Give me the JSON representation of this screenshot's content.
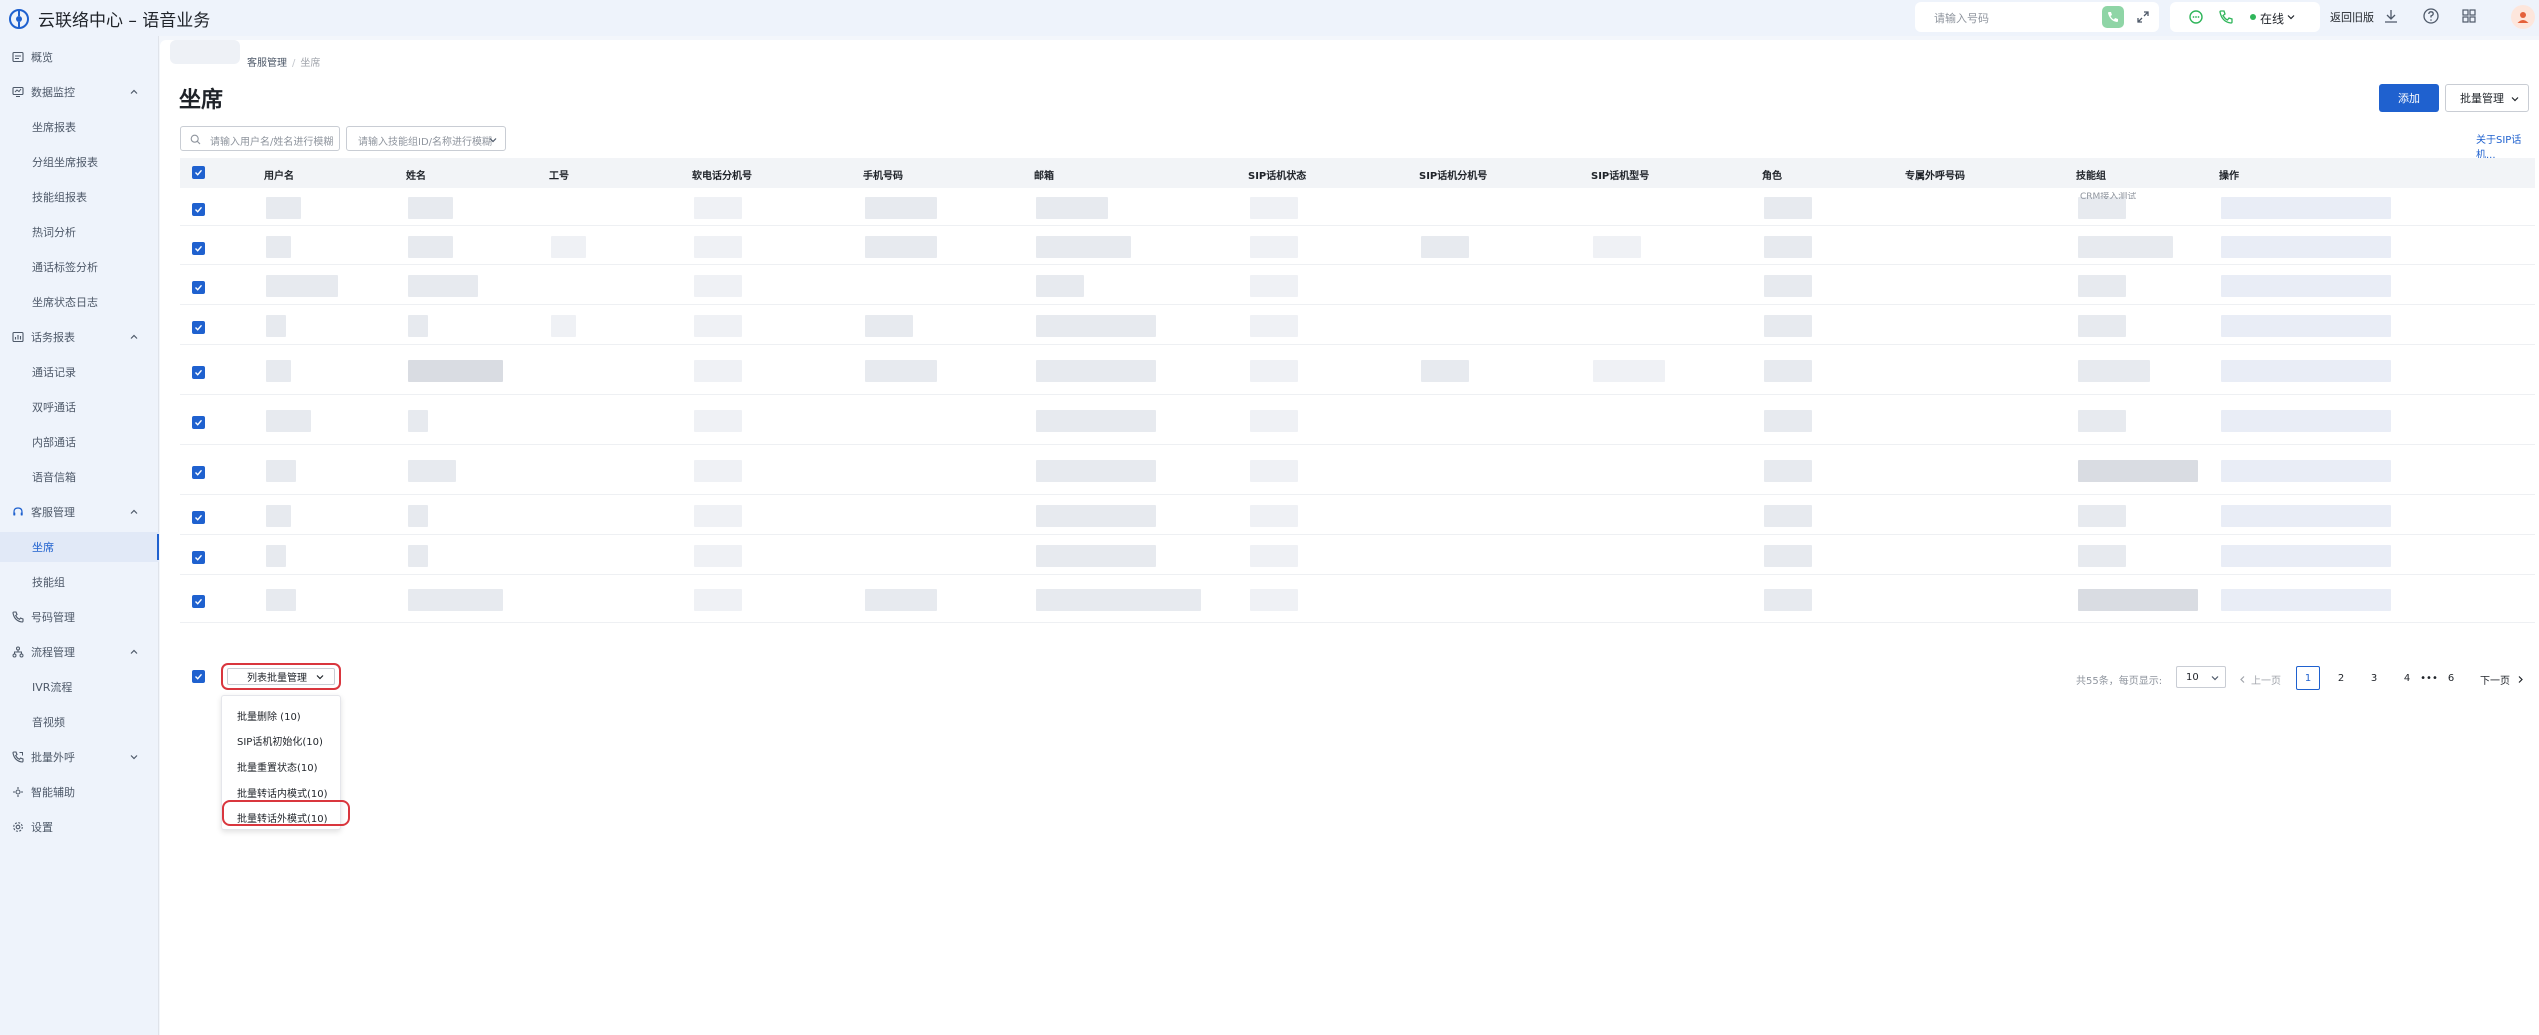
{
  "app": {
    "title": "云联络中心 – 语音业务"
  },
  "topbar": {
    "dial_placeholder": "请输入号码",
    "status_label": "在线",
    "back_old_label": "返回旧版",
    "icons": [
      "chat-icon",
      "phone-icon",
      "download-icon",
      "help-icon",
      "grid-icon"
    ]
  },
  "sidebar": {
    "items": [
      {
        "label": "概览",
        "icon": "overview-icon"
      },
      {
        "label": "数据监控",
        "icon": "monitor-icon",
        "expanded": true
      },
      {
        "label": "坐席报表"
      },
      {
        "label": "分组坐席报表"
      },
      {
        "label": "技能组报表"
      },
      {
        "label": "热词分析"
      },
      {
        "label": "通话标签分析"
      },
      {
        "label": "坐席状态日志"
      },
      {
        "label": "话务报表",
        "icon": "report-icon",
        "expanded": true
      },
      {
        "label": "通话记录"
      },
      {
        "label": "双呼通话"
      },
      {
        "label": "内部通话"
      },
      {
        "label": "语音信箱"
      },
      {
        "label": "客服管理",
        "icon": "headset-icon",
        "expanded": true
      },
      {
        "label": "坐席",
        "active": true
      },
      {
        "label": "技能组"
      },
      {
        "label": "号码管理",
        "icon": "phone-icon"
      },
      {
        "label": "流程管理",
        "icon": "flow-icon",
        "expanded": true
      },
      {
        "label": "IVR流程"
      },
      {
        "label": "音视频"
      },
      {
        "label": "批量外呼",
        "icon": "outbound-icon",
        "expanded": false
      },
      {
        "label": "智能辅助",
        "icon": "ai-icon"
      },
      {
        "label": "设置",
        "icon": "settings-icon"
      }
    ]
  },
  "breadcrumb": {
    "parent": "客服管理",
    "separator": "/",
    "current": "坐席"
  },
  "page": {
    "title": "坐席",
    "add_label": "添加",
    "batch_label": "批量管理",
    "search_placeholder": "请输入用户名/姓名进行模糊",
    "skill_placeholder": "请输入技能组ID/名称进行模糊",
    "sip_link": "关于SIP话机..."
  },
  "table": {
    "columns": [
      "用户名",
      "姓名",
      "工号",
      "软电话分机号",
      "手机号码",
      "邮箱",
      "SIP话机状态",
      "SIP话机分机号",
      "SIP话机型号",
      "角色",
      "专属外呼号码",
      "技能组",
      "操作"
    ],
    "partial_text": "CRM接入测试"
  },
  "footer": {
    "list_batch_label": "列表批量管理",
    "menu": [
      "批量删除 (10)",
      "SIP话机初始化(10)",
      "批量重置状态(10)",
      "批量转话内模式(10)",
      "批量转话外模式(10)"
    ],
    "total": "共55条，",
    "per_page_label": "每页显示:",
    "per_page": "10",
    "prev": "上一页",
    "next": "下一页",
    "pages": [
      "1",
      "2",
      "3",
      "4",
      "•••",
      "6"
    ],
    "current_page": "1"
  },
  "colors": {
    "primary": "#1f61cf",
    "highlight": "#d9363e",
    "online": "#2fb55a"
  }
}
